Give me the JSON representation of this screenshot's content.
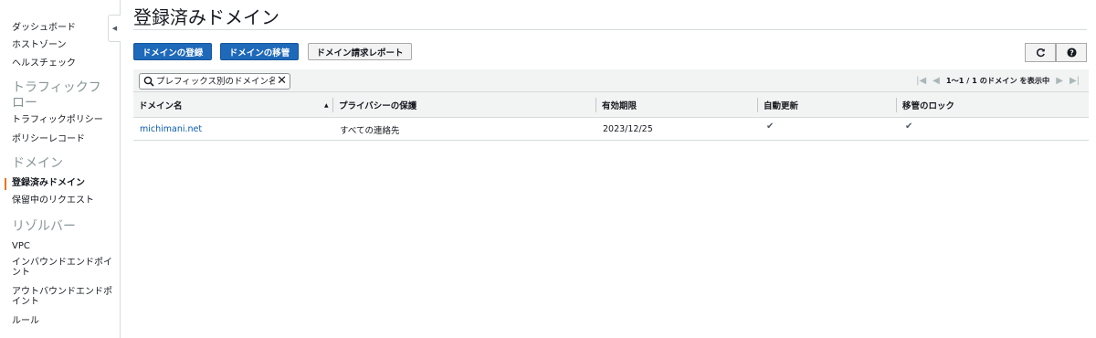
{
  "sidebar": {
    "items": {
      "dashboard": "ダッシュボード",
      "hosted_zones": "ホストゾーン",
      "health_checks": "ヘルスチェック",
      "traffic_policies": "トラフィックポリシー",
      "policy_records": "ポリシーレコード",
      "registered_domains": "登録済みドメイン",
      "pending_requests": "保留中のリクエスト",
      "vpc": "VPC",
      "inbound_endpoints": "インバウンドエンドポイント",
      "outbound_endpoints": "アウトバウンドエンドポイント",
      "rules": "ルール"
    },
    "sections": {
      "traffic_flow": "トラフィックフロー",
      "domains": "ドメイン",
      "resolver": "リゾルバー"
    },
    "active_color": "#ec7211"
  },
  "main": {
    "title": "登録済みドメイン",
    "buttons": {
      "register": "ドメインの登録",
      "transfer": "ドメインの移管",
      "billing_report": "ドメイン請求レポート"
    },
    "icons": {
      "refresh": "refresh-icon",
      "help": "help-icon"
    },
    "search": {
      "placeholder": "プレフィックス別のドメイン名でフィルタリング"
    },
    "pager": {
      "text": "1〜1 / 1 のドメイン を表示中"
    },
    "table": {
      "columns": [
        "ドメイン名",
        "プライバシーの保護",
        "有効期限",
        "自動更新",
        "移管のロック"
      ],
      "rows": [
        {
          "domain": "michimani.net",
          "privacy": "すべての連絡先",
          "expires": "2023/12/25",
          "auto_renew": "✔",
          "transfer_lock": "✔"
        }
      ]
    },
    "colors": {
      "primary": "#1e69b9",
      "link": "#0a5bb0"
    }
  }
}
